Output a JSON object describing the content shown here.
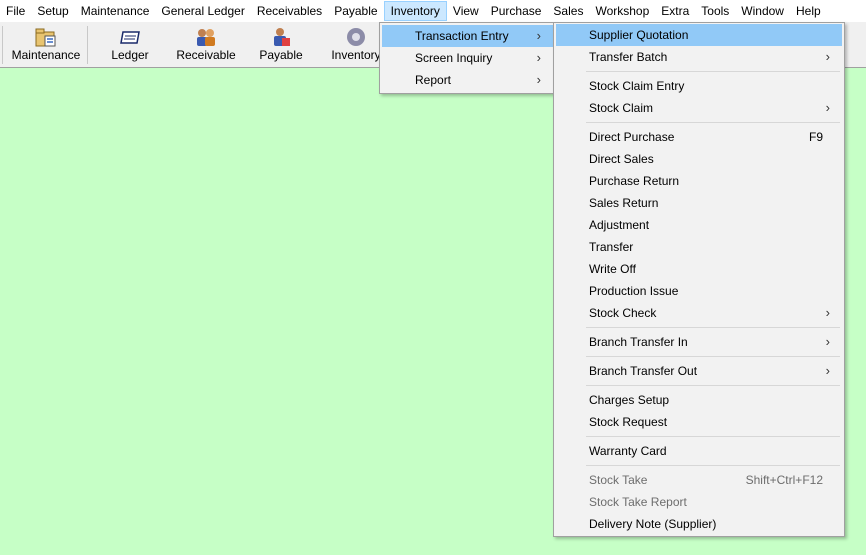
{
  "menubar": {
    "items": [
      "File",
      "Setup",
      "Maintenance",
      "General Ledger",
      "Receivables",
      "Payable",
      "Inventory",
      "View",
      "Purchase",
      "Sales",
      "Workshop",
      "Extra",
      "Tools",
      "Window",
      "Help"
    ],
    "active": "Inventory"
  },
  "toolbar": {
    "buttons": [
      {
        "label": "Maintenance",
        "icon": "maintenance-icon"
      },
      {
        "label": "Ledger",
        "icon": "ledger-icon"
      },
      {
        "label": "Receivable",
        "icon": "receivable-icon"
      },
      {
        "label": "Payable",
        "icon": "payable-icon"
      },
      {
        "label": "Inventory",
        "icon": "inventory-icon"
      }
    ]
  },
  "inventory_menu": {
    "items": [
      {
        "label": "Transaction Entry",
        "submenu": true,
        "highlighted": true
      },
      {
        "label": "Screen Inquiry",
        "submenu": true
      },
      {
        "label": "Report",
        "submenu": true
      }
    ]
  },
  "transaction_menu": {
    "groups": [
      [
        {
          "label": "Supplier Quotation",
          "highlighted": true
        },
        {
          "label": "Transfer Batch",
          "submenu": true
        }
      ],
      [
        {
          "label": "Stock Claim Entry"
        },
        {
          "label": "Stock Claim",
          "submenu": true
        }
      ],
      [
        {
          "label": "Direct Purchase",
          "shortcut": "F9"
        },
        {
          "label": "Direct Sales"
        },
        {
          "label": "Purchase Return"
        },
        {
          "label": "Sales Return"
        },
        {
          "label": "Adjustment"
        },
        {
          "label": "Transfer"
        },
        {
          "label": "Write Off"
        },
        {
          "label": "Production Issue"
        },
        {
          "label": "Stock Check",
          "submenu": true
        }
      ],
      [
        {
          "label": "Branch Transfer In",
          "submenu": true
        }
      ],
      [
        {
          "label": "Branch Transfer Out",
          "submenu": true
        }
      ],
      [
        {
          "label": "Charges Setup"
        },
        {
          "label": "Stock Request"
        }
      ],
      [
        {
          "label": "Warranty Card"
        }
      ],
      [
        {
          "label": "Stock Take",
          "shortcut": "Shift+Ctrl+F12",
          "disabled": true
        },
        {
          "label": "Stock Take Report",
          "disabled": true
        },
        {
          "label": "Delivery Note (Supplier)"
        }
      ]
    ]
  },
  "colors": {
    "background": "#c6ffc6",
    "menu_highlight": "#91c9f7",
    "menubar_active": "#cce8ff"
  }
}
